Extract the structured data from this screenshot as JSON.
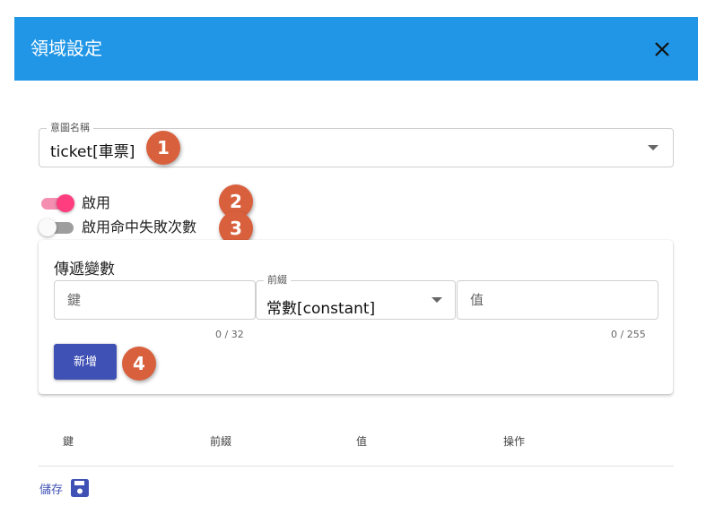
{
  "dialog": {
    "title": "領域設定"
  },
  "intent_field": {
    "label": "意圖名稱",
    "value": "ticket[車票]"
  },
  "switches": [
    {
      "label": "啟用",
      "on": true
    },
    {
      "label": "啟用命中失敗次數",
      "on": false
    }
  ],
  "variables_card": {
    "title": "傳遞變數",
    "key_placeholder": "鍵",
    "key_counter": "0 / 32",
    "prefix_label": "前綴",
    "prefix_value": "常數[constant]",
    "value_placeholder": "值",
    "value_counter": "0 / 255",
    "add_label": "新增"
  },
  "table": {
    "headers": [
      "鍵",
      "前綴",
      "值",
      "操作"
    ]
  },
  "save_label": "儲存",
  "callouts": [
    "1",
    "2",
    "3",
    "4"
  ],
  "colors": {
    "header": "#2196e6",
    "callout": "#d9603d",
    "switch_on": "#ff3d7f",
    "primary_button": "#3f51b5",
    "save_link": "#3f51b5"
  },
  "icons": {
    "close": "close-icon",
    "dropdown": "chevron-down-icon",
    "save": "floppy-disk-icon"
  }
}
